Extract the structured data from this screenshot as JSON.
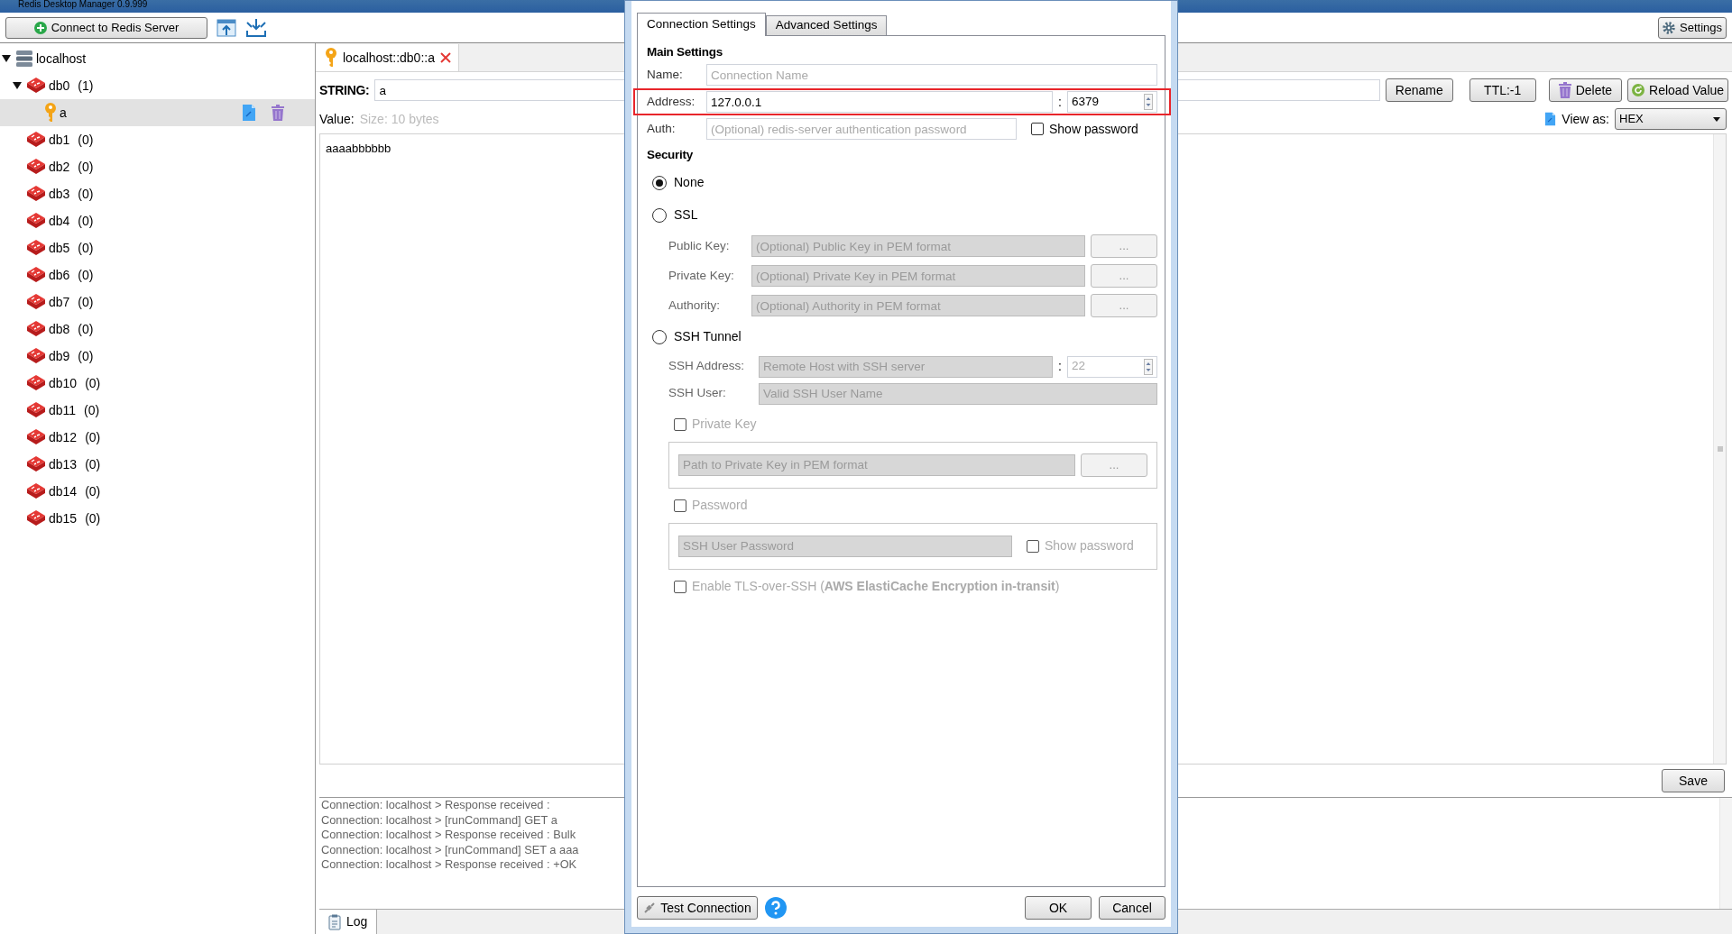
{
  "window": {
    "title": "Redis Desktop Manager 0.9.999"
  },
  "toolbar": {
    "connect_button": "Connect to Redis Server",
    "settings_button": "Settings"
  },
  "tree": [
    {
      "label": "localhost",
      "kind": "server",
      "expanded": true,
      "selected": false,
      "children": [
        {
          "label": "db0",
          "count": "(1)",
          "kind": "db",
          "expanded": true,
          "selected": false,
          "children": [
            {
              "label": "a",
              "kind": "key",
              "selected": true
            }
          ]
        },
        {
          "label": "db1",
          "count": "(0)",
          "kind": "db",
          "selected": false
        },
        {
          "label": "db2",
          "count": "(0)",
          "kind": "db",
          "selected": false
        },
        {
          "label": "db3",
          "count": "(0)",
          "kind": "db",
          "selected": false
        },
        {
          "label": "db4",
          "count": "(0)",
          "kind": "db",
          "selected": false
        },
        {
          "label": "db5",
          "count": "(0)",
          "kind": "db",
          "selected": false
        },
        {
          "label": "db6",
          "count": "(0)",
          "kind": "db",
          "selected": false
        },
        {
          "label": "db7",
          "count": "(0)",
          "kind": "db",
          "selected": false
        },
        {
          "label": "db8",
          "count": "(0)",
          "kind": "db",
          "selected": false
        },
        {
          "label": "db9",
          "count": "(0)",
          "kind": "db",
          "selected": false
        },
        {
          "label": "db10",
          "count": "(0)",
          "kind": "db",
          "selected": false
        },
        {
          "label": "db11",
          "count": "(0)",
          "kind": "db",
          "selected": false
        },
        {
          "label": "db12",
          "count": "(0)",
          "kind": "db",
          "selected": false
        },
        {
          "label": "db13",
          "count": "(0)",
          "kind": "db",
          "selected": false
        },
        {
          "label": "db14",
          "count": "(0)",
          "kind": "db",
          "selected": false
        },
        {
          "label": "db15",
          "count": "(0)",
          "kind": "db",
          "selected": false
        }
      ]
    }
  ],
  "value_tab": {
    "title": "localhost::db0::a"
  },
  "key_panel": {
    "type_label": "STRING:",
    "key_value": "a",
    "rename_button": "Rename",
    "ttl_button": "TTL:-1",
    "delete_button": "Delete",
    "reload_button": "Reload Value",
    "value_label": "Value:",
    "size": "Size: 10 bytes",
    "view_as_label": "View as:",
    "view_as": "HEX",
    "value_text": "aaaabbbbbb",
    "save_button": "Save"
  },
  "log": {
    "lines": [
      "Connection: localhost > Response received :",
      "Connection: localhost > [runCommand] GET a",
      "Connection: localhost > Response received : Bulk",
      "Connection: localhost > [runCommand] SET a aaa",
      "Connection: localhost > Response received : +OK"
    ],
    "tab": "Log"
  },
  "dialog": {
    "tabs": [
      {
        "label": "Connection Settings",
        "selected": true
      },
      {
        "label": "Advanced Settings",
        "selected": false
      }
    ],
    "main_heading": "Main Settings",
    "name": {
      "label": "Name:",
      "placeholder": "Connection Name"
    },
    "address": {
      "label": "Address:",
      "value": "127.0.0.1",
      "separator": ":",
      "port": "6379",
      "highlighted": true
    },
    "auth": {
      "label": "Auth:",
      "placeholder": "(Optional) redis-server authentication password",
      "show_password": {
        "label": "Show password",
        "checked": false
      }
    },
    "security_heading": "Security",
    "security_options": [
      {
        "label": "None",
        "selected": true
      },
      {
        "label": "SSL",
        "selected": false
      },
      {
        "label": "SSH Tunnel",
        "selected": false
      }
    ],
    "ssl_fields": [
      {
        "label": "Public Key:",
        "placeholder": "(Optional) Public Key in PEM format",
        "browse": "...",
        "disabled": true
      },
      {
        "label": "Private Key:",
        "placeholder": "(Optional) Private Key in PEM format",
        "browse": "...",
        "disabled": true
      },
      {
        "label": "Authority:",
        "placeholder": "(Optional) Authority in PEM format",
        "browse": "...",
        "disabled": true
      }
    ],
    "ssh": {
      "address": {
        "label": "SSH Address:",
        "placeholder": "Remote Host with SSH server",
        "separator": ":",
        "port_placeholder": "22",
        "disabled": true
      },
      "user": {
        "label": "SSH User:",
        "placeholder": "Valid SSH User Name",
        "disabled": true
      },
      "private_key": {
        "label": "Private Key",
        "checked": false,
        "disabled": true,
        "path_placeholder": "Path to Private Key in PEM format",
        "browse": "..."
      },
      "password": {
        "label": "Password",
        "checked": false,
        "disabled": true,
        "placeholder": "SSH User Password",
        "show_password": {
          "label": "Show password",
          "checked": false
        }
      },
      "tls": {
        "label": "Enable TLS-over-SSH (**AWS ElastiCache Encryption in-transit**)",
        "checked": false,
        "disabled": true
      }
    },
    "buttons": {
      "test": "Test Connection",
      "ok": "OK",
      "cancel": "Cancel"
    }
  }
}
